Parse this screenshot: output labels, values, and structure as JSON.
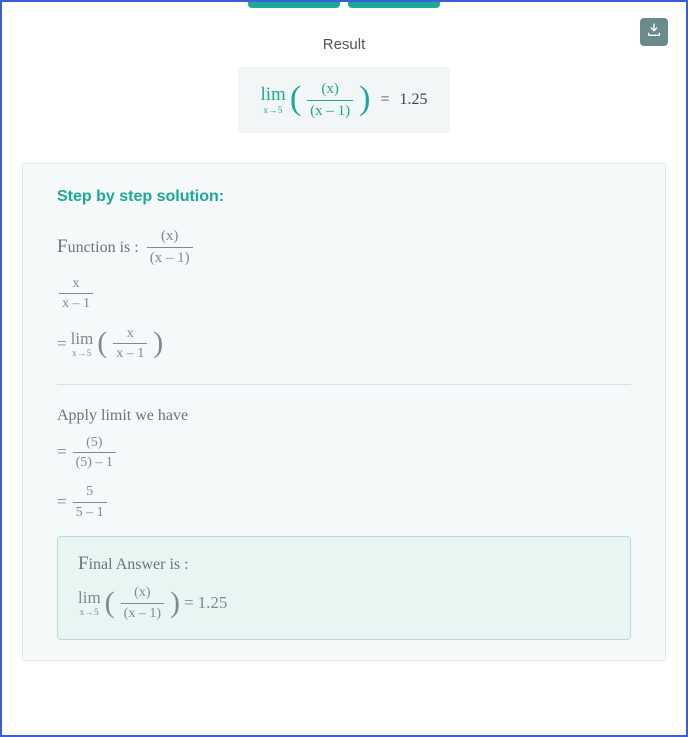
{
  "result": {
    "title": "Result",
    "lim_label": "lim",
    "lim_sub": "x→5",
    "frac_num": "(x)",
    "frac_den": "(x – 1)",
    "eq": "=",
    "value": "1.25"
  },
  "steps_title": "Step by step solution:",
  "line_function": {
    "prefix_drop": "F",
    "prefix_rest": "unction is :",
    "frac_num": "(x)",
    "frac_den": "(x – 1)"
  },
  "line_frac1": {
    "num": "x",
    "den": "x – 1"
  },
  "line_lim1": {
    "eq": "=",
    "lim_label": "lim",
    "lim_sub": "x→5",
    "frac_num": "x",
    "frac_den": "x – 1"
  },
  "line_apply": "Apply limit we have",
  "line_frac2": {
    "eq": "=",
    "num": "(5)",
    "den": "(5) – 1"
  },
  "line_frac3": {
    "eq": "=",
    "num": "5",
    "den": "5 – 1"
  },
  "final": {
    "title_drop": "F",
    "title_rest": "inal Answer is :",
    "lim_label": "lim",
    "lim_sub": "x→5",
    "frac_num": "(x)",
    "frac_den": "(x – 1)",
    "eq": "=",
    "value": "1.25"
  }
}
